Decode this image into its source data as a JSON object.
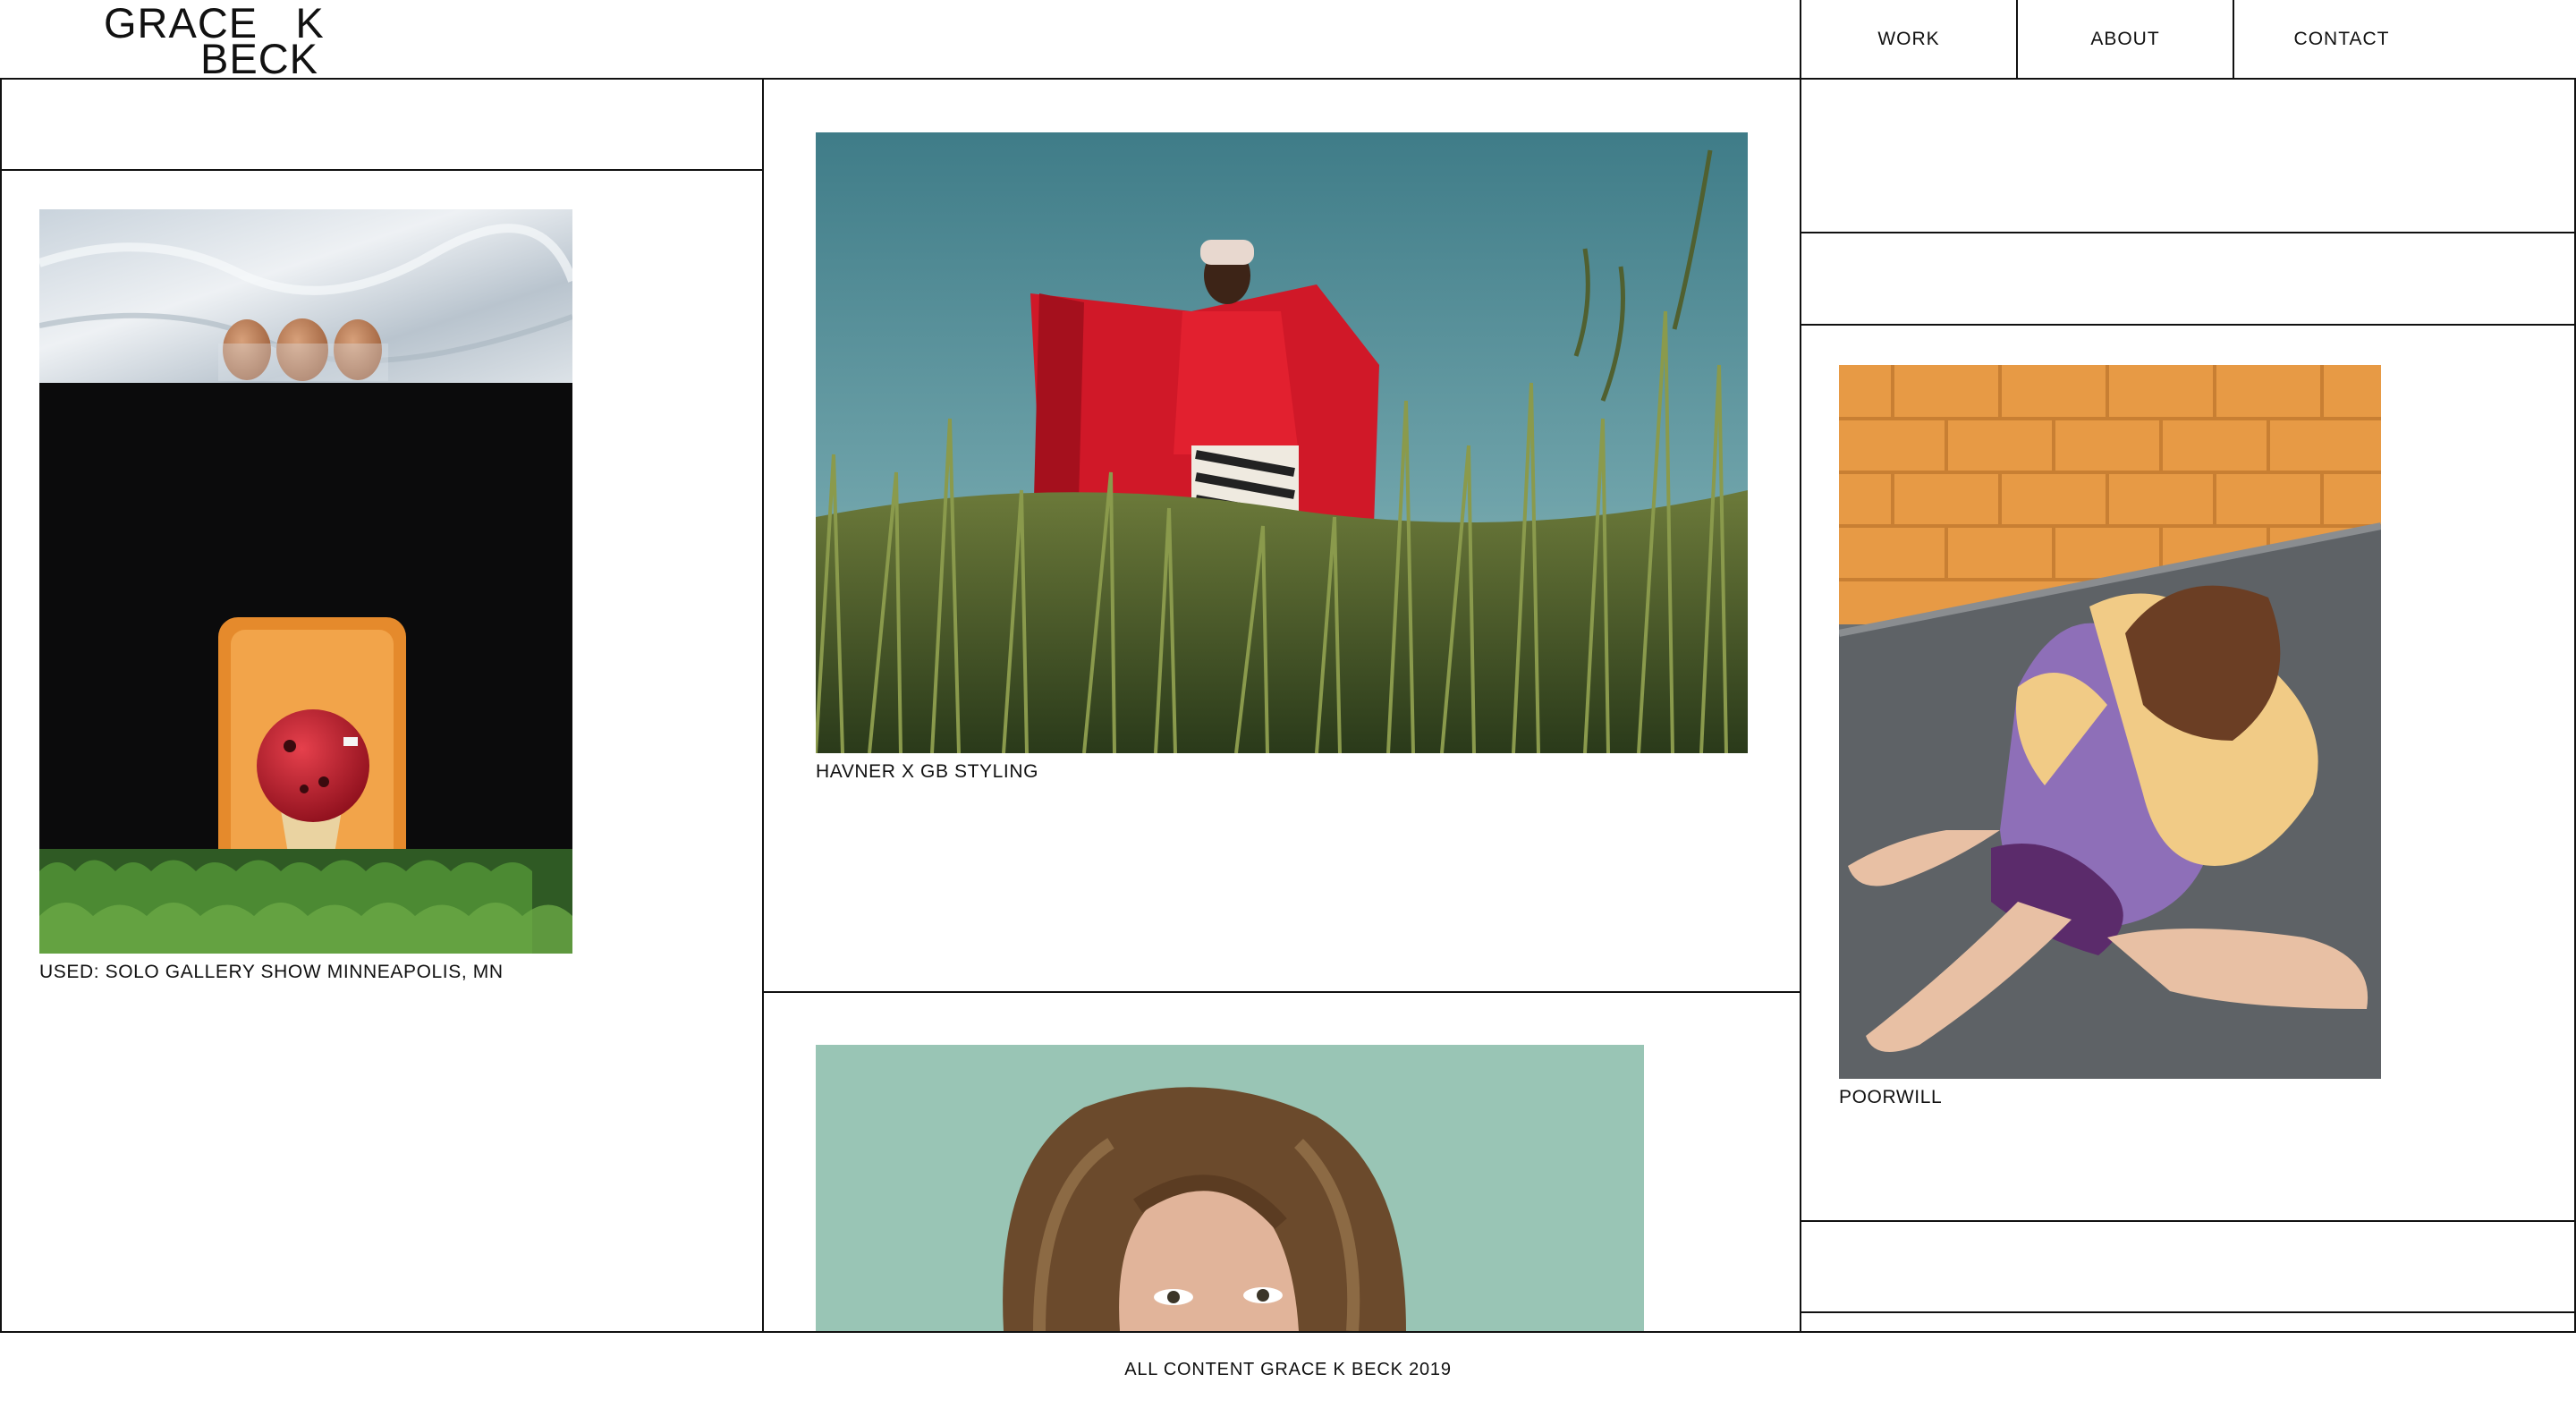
{
  "brand": {
    "line1": "GRACE   K",
    "line2": "BECK"
  },
  "nav": {
    "items": [
      "WORK",
      "ABOUT",
      "CONTACT"
    ]
  },
  "projects": [
    {
      "caption": "USED: SOLO GALLERY SHOW MINNEAPOLIS, MN"
    },
    {
      "caption": "HAVNER X GB STYLING"
    },
    {
      "caption": "POORWILL"
    }
  ],
  "footer": {
    "text": "ALL CONTENT GRACE K BECK 2019"
  },
  "colors": {
    "line": "#111111",
    "background": "#ffffff"
  }
}
